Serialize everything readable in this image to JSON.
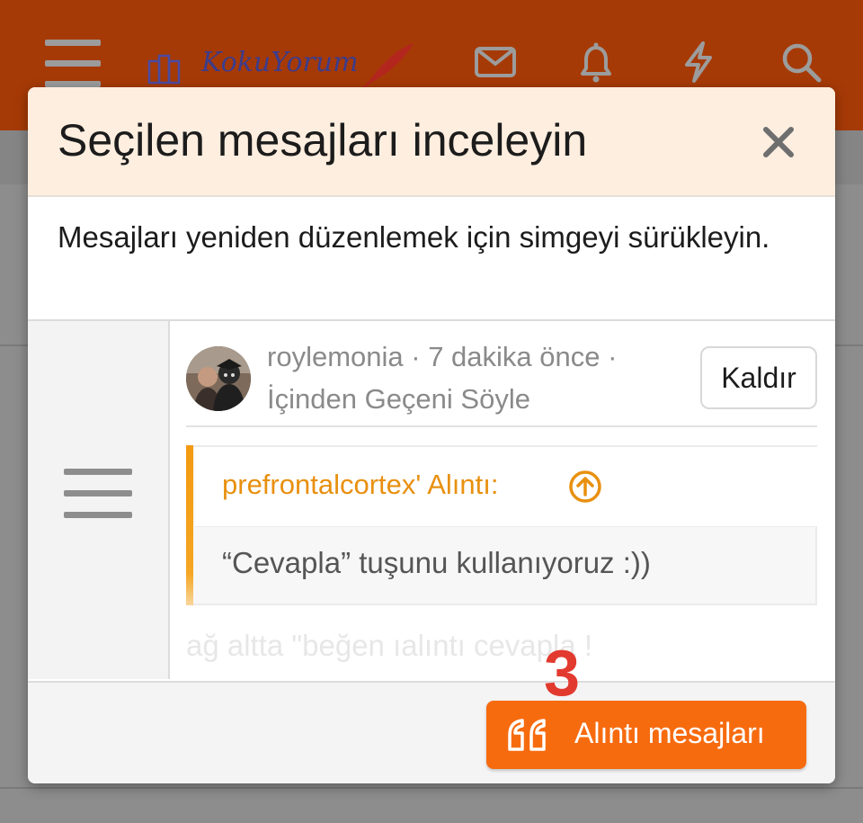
{
  "app": {
    "logo_text": "KokuYorum"
  },
  "topbar_icons": [
    "menu-icon",
    "mail-icon",
    "bell-icon",
    "bolt-icon",
    "search-icon"
  ],
  "modal": {
    "title": "Seçilen mesajları inceleyin",
    "description": "Mesajları yeniden düzenlemek için simgeyi sürükleyin.",
    "message": {
      "author": "roylemonia",
      "time": "7 dakika önce",
      "thread": "İçinden Geçeni Söyle",
      "remove_label": "Kaldır",
      "quote_author": "prefrontalcortex' Alıntı:",
      "quote_text": "“Cevapla” tuşunu kullanıyoruz :))",
      "faded_text": "ağ altta \"beğen  ıalıntı  cevapla !"
    },
    "step_number": "3",
    "quote_button_label": "Alıntı mesajları"
  },
  "colors": {
    "topbar": "#a63a06",
    "accent": "#f76b0f",
    "quote_author": "#e8900f",
    "step_number": "#e23a2f",
    "modal_header": "#feeedf"
  }
}
